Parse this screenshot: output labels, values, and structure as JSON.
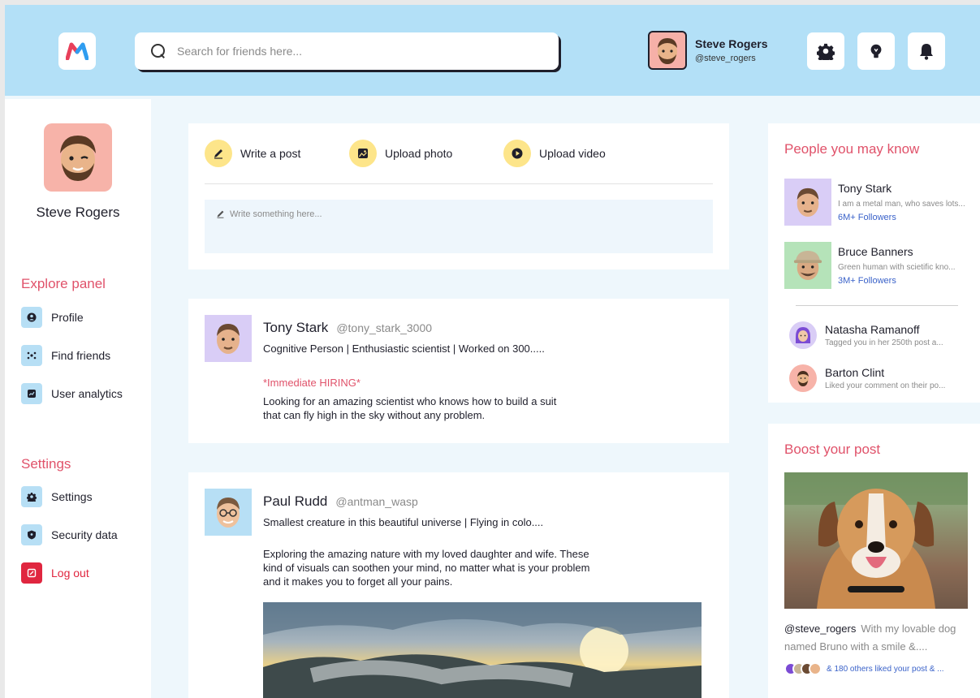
{
  "header": {
    "search_placeholder": "Search for friends here...",
    "user_name": "Steve Rogers",
    "user_handle": "@steve_rogers"
  },
  "sidebar": {
    "user_name": "Steve Rogers",
    "explore_title": "Explore panel",
    "explore_items": [
      {
        "label": "Profile",
        "icon": "profile-icon"
      },
      {
        "label": "Find friends",
        "icon": "find-friends-icon"
      },
      {
        "label": "User analytics",
        "icon": "analytics-icon"
      }
    ],
    "settings_title": "Settings",
    "settings_items": [
      {
        "label": "Settings",
        "icon": "gear-icon"
      },
      {
        "label": "Security data",
        "icon": "shield-icon"
      },
      {
        "label": "Log out",
        "icon": "logout-icon"
      }
    ]
  },
  "composer": {
    "write_post": "Write a post",
    "upload_photo": "Upload photo",
    "upload_video": "Upload video",
    "input_placeholder": "Write something here..."
  },
  "posts": [
    {
      "name": "Tony Stark",
      "handle": "@tony_stark_3000",
      "bio": "Cognitive Person | Enthusiastic scientist | Worked on 300.....",
      "tag": "*Immediate HIRING*",
      "body_lines": [
        "Looking for an amazing scientist who knows how to build a suit",
        "that can fly high in the sky without any problem."
      ]
    },
    {
      "name": "Paul Rudd",
      "handle": "@antman_wasp",
      "bio": "Smallest creature in this beautiful universe | Flying in colo....",
      "body_lines": [
        "Exploring the amazing nature with my loved daughter and wife. These",
        "kind of visuals can soothen your mind, no matter what is your problem",
        "and it makes you to forget all your pains."
      ]
    }
  ],
  "people": {
    "title": "People you may know",
    "featured": [
      {
        "name": "Tony Stark",
        "desc": "I am a metal man, who saves lots...",
        "followers": "6M+ Followers"
      },
      {
        "name": "Bruce Banners",
        "desc": "Green human with scietific kno...",
        "followers": "3M+ Followers"
      }
    ],
    "others": [
      {
        "name": "Natasha Ramanoff",
        "desc": "Tagged you in her 250th post a..."
      },
      {
        "name": "Barton Clint",
        "desc": "Liked your comment on their po..."
      }
    ]
  },
  "boost": {
    "title": "Boost your post",
    "handle": "@steve_rogers",
    "caption": "With my lovable dog named Bruno with a smile &....",
    "likes": "& 180 others liked your post & ..."
  },
  "colors": {
    "header_bg": "#b3e0f7",
    "accent_red": "#e0526a",
    "link_blue": "#3a62c9",
    "action_yellow": "#fde58a"
  }
}
